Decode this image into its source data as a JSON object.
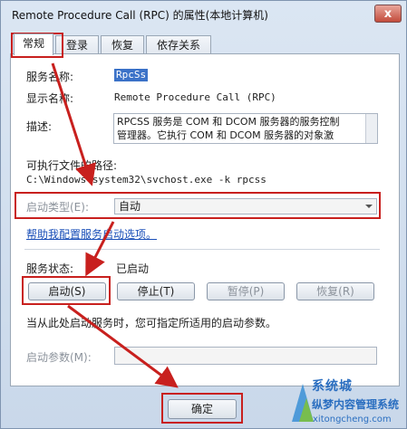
{
  "window": {
    "title": "Remote Procedure Call (RPC) 的属性(本地计算机)",
    "close_glyph": "x"
  },
  "tabs": [
    {
      "label": "常规",
      "active": true
    },
    {
      "label": "登录",
      "active": false
    },
    {
      "label": "恢复",
      "active": false
    },
    {
      "label": "依存关系",
      "active": false
    }
  ],
  "general": {
    "service_name_label": "服务名称:",
    "service_name_value": "RpcSs",
    "display_name_label": "显示名称:",
    "display_name_value": "Remote Procedure Call (RPC)",
    "description_label": "描述:",
    "description_line1": "RPCSS 服务是 COM 和 DCOM 服务器的服务控制",
    "description_line2": "管理器。它执行 COM 和 DCOM 服务器的对象激",
    "exe_path_label": "可执行文件的路径:",
    "exe_path_value": "C:\\Windows\\system32\\svchost.exe -k rpcss",
    "startup_type_label": "启动类型(E):",
    "startup_type_value": "自动",
    "help_link": "帮助我配置服务启动选项。",
    "status_label": "服务状态:",
    "status_value": "已启动",
    "start_button": "启动(S)",
    "stop_button": "停止(T)",
    "pause_button": "暂停(P)",
    "resume_button": "恢复(R)",
    "hint_text": "当从此处启动服务时，您可指定所适用的启动参数。",
    "start_params_label": "启动参数(M):",
    "start_params_value": "",
    "ok_button": "确定"
  },
  "watermark": {
    "brand_en": "系统城",
    "brand_cn": "纵梦内容管理系统",
    "url": "xitongcheng.com"
  },
  "colors": {
    "annotation_red": "#c8201e",
    "selection_blue": "#3b72c8",
    "link_blue": "#1a4fb8"
  }
}
